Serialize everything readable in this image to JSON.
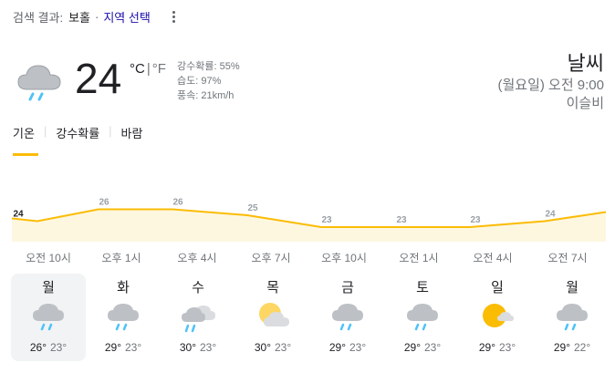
{
  "search": {
    "label": "검색 결과:",
    "location": "보홀",
    "separator": "·",
    "select_region": "지역 선택"
  },
  "current": {
    "temp": "24",
    "unit_c": "°C",
    "unit_sep": "|",
    "unit_f": "°F",
    "precip": "강수확률: 55%",
    "humidity": "습도: 97%",
    "wind": "풍속: 21km/h",
    "icon": "cloud-rain-icon"
  },
  "header": {
    "title": "날씨",
    "datetime": "(월요일) 오전 9:00",
    "condition": "이슬비"
  },
  "tabs": [
    {
      "label": "기온",
      "active": true
    },
    {
      "label": "강수확률",
      "active": false
    },
    {
      "label": "바람",
      "active": false
    }
  ],
  "chart_data": {
    "type": "area",
    "x": [
      "오전 10시",
      "오후 1시",
      "오후 4시",
      "오후 7시",
      "오후 10시",
      "오전 1시",
      "오전 4시",
      "오전 7시"
    ],
    "values": [
      24,
      26,
      26,
      25,
      23,
      23,
      23,
      24
    ],
    "color": "#fbbc04",
    "fill": "#fef7e0"
  },
  "days": [
    {
      "name": "월",
      "hi": "26°",
      "lo": "23°",
      "icon": "cloud-rain-icon",
      "selected": true
    },
    {
      "name": "화",
      "hi": "29°",
      "lo": "23°",
      "icon": "cloud-rain-icon",
      "selected": false
    },
    {
      "name": "수",
      "hi": "30°",
      "lo": "23°",
      "icon": "showers-cloud-icon",
      "selected": false
    },
    {
      "name": "목",
      "hi": "30°",
      "lo": "23°",
      "icon": "partly-cloudy-icon",
      "selected": false
    },
    {
      "name": "금",
      "hi": "29°",
      "lo": "23°",
      "icon": "cloud-rain-icon",
      "selected": false
    },
    {
      "name": "토",
      "hi": "29°",
      "lo": "23°",
      "icon": "cloud-rain-icon",
      "selected": false
    },
    {
      "name": "일",
      "hi": "29°",
      "lo": "23°",
      "icon": "sun-cloud-icon",
      "selected": false
    },
    {
      "name": "월",
      "hi": "29°",
      "lo": "22°",
      "icon": "cloud-rain-icon",
      "selected": false
    }
  ]
}
